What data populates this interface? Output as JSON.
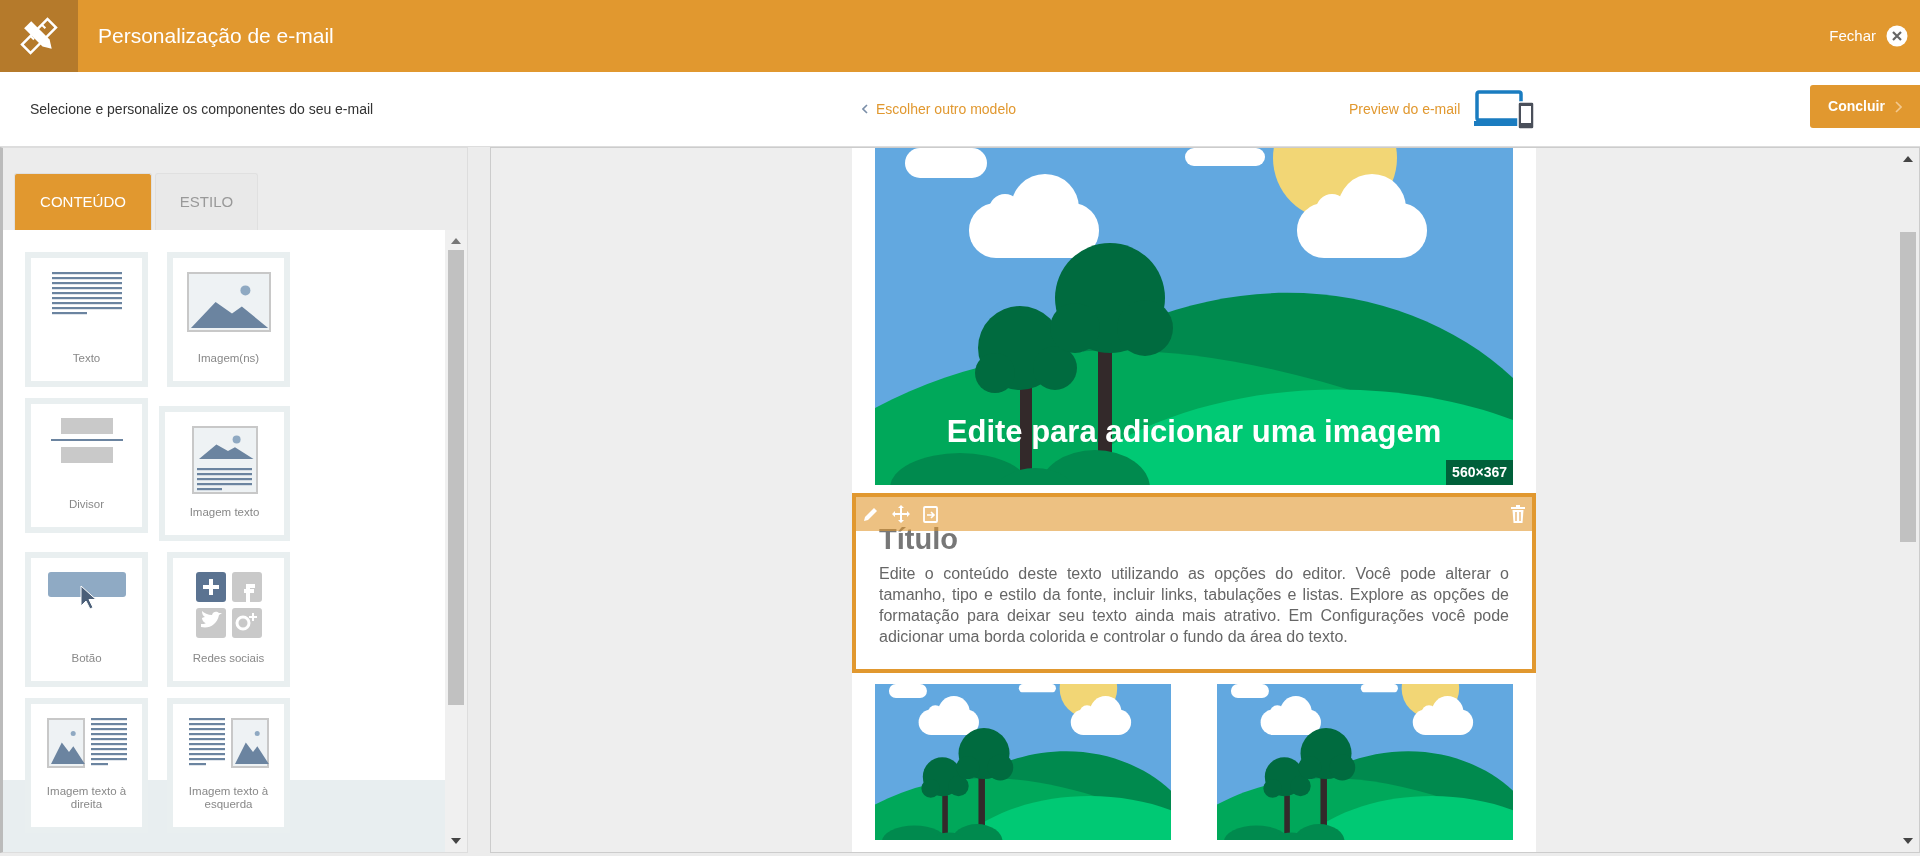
{
  "header": {
    "title": "Personalização de e-mail",
    "close_label": "Fechar"
  },
  "subheader": {
    "instruction": "Selecione e personalize os componentes do seu e-mail",
    "back_link": "Escolher outro modelo",
    "preview_link": "Preview do e-mail",
    "finish_button": "Concluir"
  },
  "tabs": [
    {
      "label": "CONTEÚDO",
      "selected": true
    },
    {
      "label": "ESTILO",
      "selected": false
    }
  ],
  "components": [
    {
      "label": "Texto",
      "kind": "text"
    },
    {
      "label": "Imagem(ns)",
      "kind": "image"
    },
    {
      "label": "Divisor",
      "kind": "divider"
    },
    {
      "label": "Imagem texto",
      "kind": "image-text"
    },
    {
      "label": "Botão",
      "kind": "button"
    },
    {
      "label": "Redes sociais",
      "kind": "social"
    },
    {
      "label": "Imagem texto à direita",
      "kind": "image-text-right"
    },
    {
      "label": "Imagem texto à esquerda",
      "kind": "image-text-left"
    }
  ],
  "email": {
    "hero": {
      "caption": "Edite para adicionar uma imagem",
      "size_badge": "560×367"
    },
    "text_block": {
      "selected": true,
      "title": "Título",
      "body": "Edite o conteúdo deste texto utilizando as opções do editor. Você pode alterar o tamanho, tipo e estilo da fonte, incluir links, tabulações e listas. Explore as opções de formatação para deixar seu texto ainda mais atrativo. Em Configurações você pode adicionar uma borda colorida e controlar o fundo da área do texto."
    }
  }
}
